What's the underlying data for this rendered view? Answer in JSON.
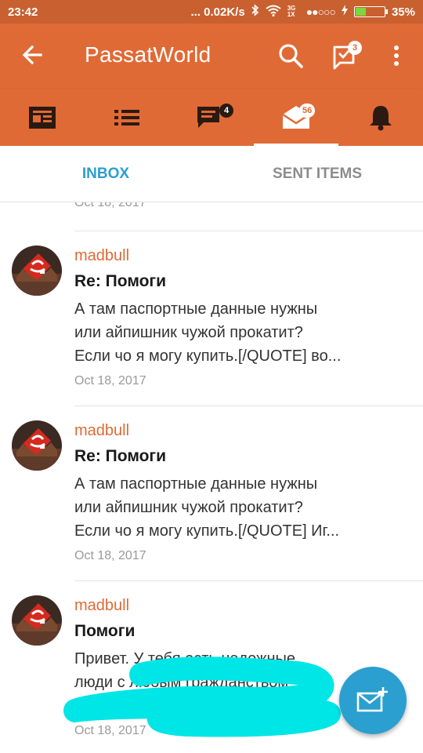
{
  "status_bar": {
    "time": "23:42",
    "speed": "... 0.02K/s",
    "network": "3G 1X",
    "signal_dots": "●●○○○",
    "battery_percent": "35%",
    "battery_level": 0.35
  },
  "app_bar": {
    "title": "PassatWorld",
    "conversations_badge": "3"
  },
  "tabs": [
    {
      "icon": "news-icon",
      "badge": ""
    },
    {
      "icon": "list-icon",
      "badge": ""
    },
    {
      "icon": "chat-icon",
      "badge": "4"
    },
    {
      "icon": "mail-icon",
      "badge": "56",
      "active": true
    },
    {
      "icon": "bell-icon",
      "badge": ""
    }
  ],
  "subtabs": {
    "inbox": "INBOX",
    "sent": "SENT ITEMS"
  },
  "partial_date": "Oct 18, 2017",
  "messages": [
    {
      "author": "madbull",
      "subject": "Re: Помоги",
      "preview": [
        "А там паспортные данные нужны",
        "или айпишник чужой прокатит?",
        "Если чо я могу купить.[/QUOTE] во..."
      ],
      "date": "Oct 18, 2017"
    },
    {
      "author": "madbull",
      "subject": "Re: Помоги",
      "preview": [
        "А там паспортные данные нужны",
        "или айпишник чужой прокатит?",
        "Если чо я могу купить.[/QUOTE] Иг..."
      ],
      "date": "Oct 18, 2017"
    },
    {
      "author": "madbull",
      "subject": "Помоги",
      "preview": [
        "Привет. У тебя есть надежные",
        "люди с любым гражданством",
        ""
      ],
      "date": "Oct 18, 2017"
    }
  ],
  "colors": {
    "accent": "#e06a35",
    "status_bar": "#c9602f",
    "link_blue": "#2a9fd0",
    "scribble": "#00e5e5"
  }
}
